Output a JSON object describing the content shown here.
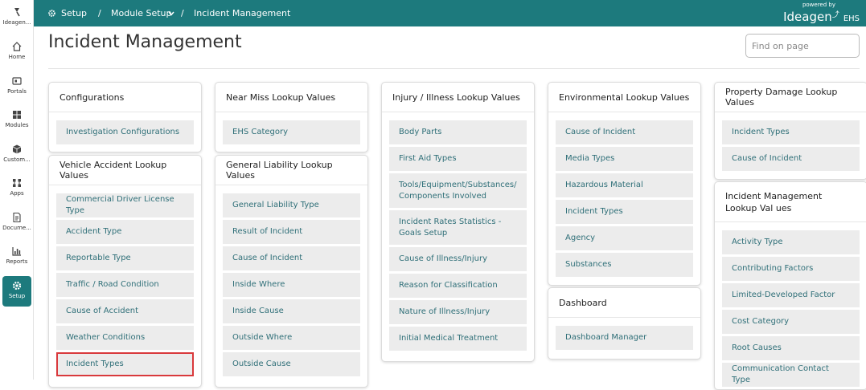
{
  "sidebar": {
    "items": [
      {
        "label": "Ideagen...",
        "icon": "ideagen-logo-icon"
      },
      {
        "label": "Home",
        "icon": "home-icon"
      },
      {
        "label": "Portals",
        "icon": "portals-icon"
      },
      {
        "label": "Modules",
        "icon": "modules-grid-icon"
      },
      {
        "label": "Custom...",
        "icon": "custom-cube-icon"
      },
      {
        "label": "Apps",
        "icon": "apps-icon"
      },
      {
        "label": "Docume...",
        "icon": "document-icon"
      },
      {
        "label": "Reports",
        "icon": "reports-chart-icon"
      },
      {
        "label": "Setup",
        "icon": "gear-icon"
      }
    ],
    "active_color": "#1d7a7d"
  },
  "topbar": {
    "setup": "Setup",
    "sep": "/",
    "module_setup": "Module Setup",
    "current": "Incident Management",
    "powered_by": "powered by",
    "brand": "Ideagen",
    "brand_suffix": "EHS",
    "color": "#1d7a7d"
  },
  "page": {
    "title": "Incident Management",
    "find_placeholder": "Find on page"
  },
  "cards": {
    "configurations": {
      "title": "Configurations",
      "items": [
        "Investigation Configurations"
      ]
    },
    "vehicle": {
      "title": "Vehicle Accident Lookup Values",
      "items": [
        "Commercial Driver License Type",
        "Accident Type",
        "Reportable Type",
        "Traffic / Road Condition",
        "Cause of Accident",
        "Weather Conditions",
        "Incident Types"
      ]
    },
    "nearmiss": {
      "title": "Near Miss Lookup Values",
      "items": [
        "EHS Category"
      ]
    },
    "general": {
      "title": "General Liability Lookup Values",
      "items": [
        "General Liability Type",
        "Result of Incident",
        "Cause of Incident",
        "Inside Where",
        "Inside Cause",
        "Outside Where",
        "Outside Cause"
      ]
    },
    "injury": {
      "title": "Injury / Illness Lookup Values",
      "items": [
        "Body Parts",
        "First Aid Types",
        "Tools/Equipment/Substances/ Components Involved",
        "Incident Rates Statistics - Goals Setup",
        "Cause of Illness/Injury",
        "Reason for Classification",
        "Nature of Illness/Injury",
        "Initial Medical Treatment"
      ]
    },
    "environmental": {
      "title": "Environmental Lookup Values",
      "items": [
        "Cause of Incident",
        "Media Types",
        "Hazardous Material",
        "Incident Types",
        "Agency",
        "Substances"
      ]
    },
    "dashboard": {
      "title": "Dashboard",
      "items": [
        "Dashboard Manager"
      ]
    },
    "property": {
      "title": "Property Damage Lookup Values",
      "items": [
        "Incident Types",
        "Cause of Incident"
      ]
    },
    "incident_mgmt": {
      "title": "Incident Management Lookup Val ues",
      "items": [
        "Activity Type",
        "Contributing Factors",
        "Limited-Developed Factor",
        "Cost Category",
        "Root Causes",
        "Communication Contact Type"
      ]
    }
  }
}
